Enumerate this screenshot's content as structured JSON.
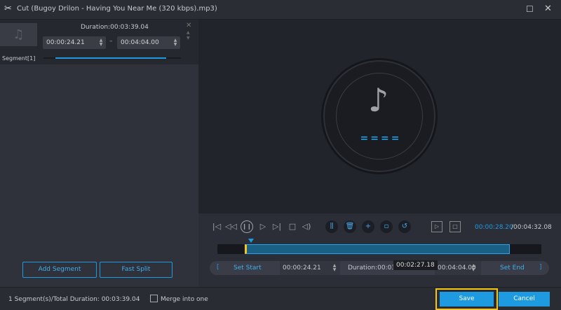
{
  "window": {
    "title": "Cut (Bugoy Drilon - Having You Near Me (320 kbps).mp3)"
  },
  "segment": {
    "duration": "Duration:00:03:39.04",
    "start": "00:00:24.21",
    "end": "00:04:04.00",
    "label": "Segment[1]"
  },
  "left_buttons": {
    "add_segment": "Add Segment",
    "fast_split": "Fast Split"
  },
  "player": {
    "current_time": "00:00:28.20",
    "total_time": "/00:04:32.08",
    "progress": 0.1
  },
  "timeline": {
    "start_marker": "[",
    "set_start": "Set Start",
    "start": "00:00:24.21",
    "duration": "Duration:00:03:39.04",
    "tooltip": "00:02:27.18",
    "end": "00:04:04.00",
    "set_end": "Set End",
    "end_marker": "]"
  },
  "footer": {
    "summary": "1 Segment(s)/Total Duration: 00:03:39.04",
    "merge": "Merge into one",
    "merge_checked": false,
    "save": "Save",
    "cancel": "Cancel"
  },
  "colors": {
    "accent": "#1e9be0",
    "highlight": "#f5c518"
  }
}
